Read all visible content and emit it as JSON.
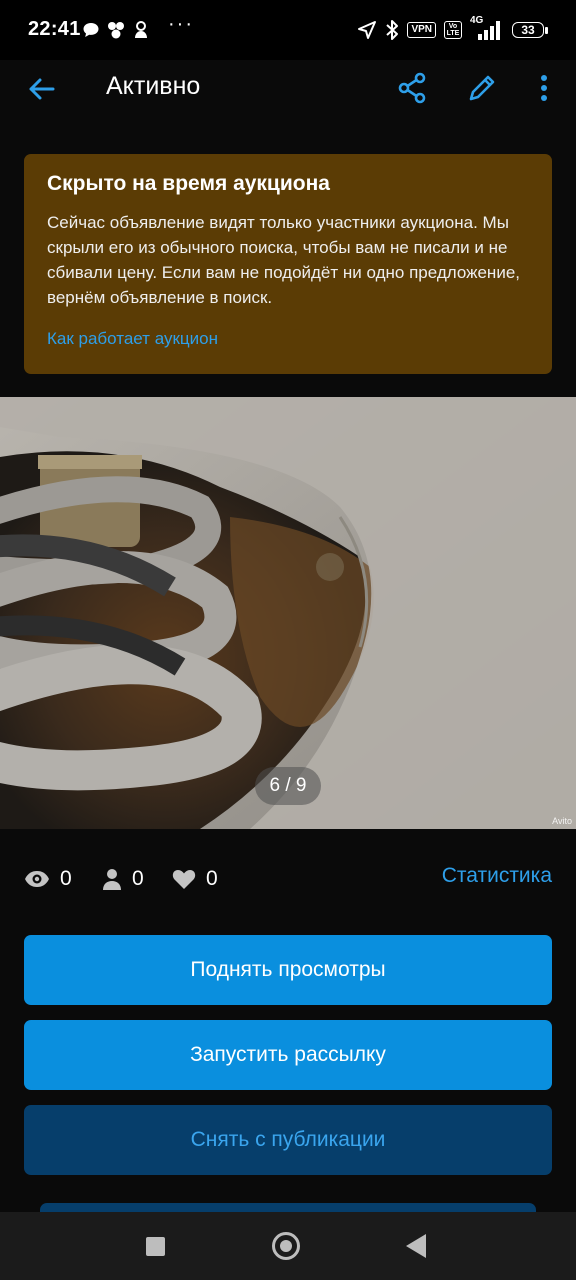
{
  "status_bar": {
    "time": "22:41",
    "left_icons": [
      "message-icon",
      "cluster-icon",
      "mascot-icon"
    ],
    "overflow": "···",
    "vpn": "VPN",
    "volte": "Vo LTE",
    "network": "4G",
    "battery": "33"
  },
  "appbar": {
    "title": "Активно"
  },
  "notice": {
    "title": "Скрыто на время аукциона",
    "text": "Сейчас объявление видят только участники аукциона. Мы скрыли его из обычного поиска, чтобы вам не писали и не сбивали цену. Если вам не подойдёт ни одно предложение, вернём объявление в поиск.",
    "link": "Как работает аукцион",
    "background": "#5b3c05"
  },
  "photo": {
    "counter": "6 / 9",
    "watermark": "Avito"
  },
  "stats": {
    "views": "0",
    "contacts": "0",
    "favorites": "0",
    "link": "Статистика"
  },
  "actions": {
    "raise_views": "Поднять просмотры",
    "start_mailing": "Запустить рассылку",
    "unpublish": "Снять с публикации"
  },
  "colors": {
    "accent": "#0a8fde",
    "link": "#2e9fe9",
    "notice_bg": "#5b3c05",
    "background": "#0a0a0a"
  }
}
